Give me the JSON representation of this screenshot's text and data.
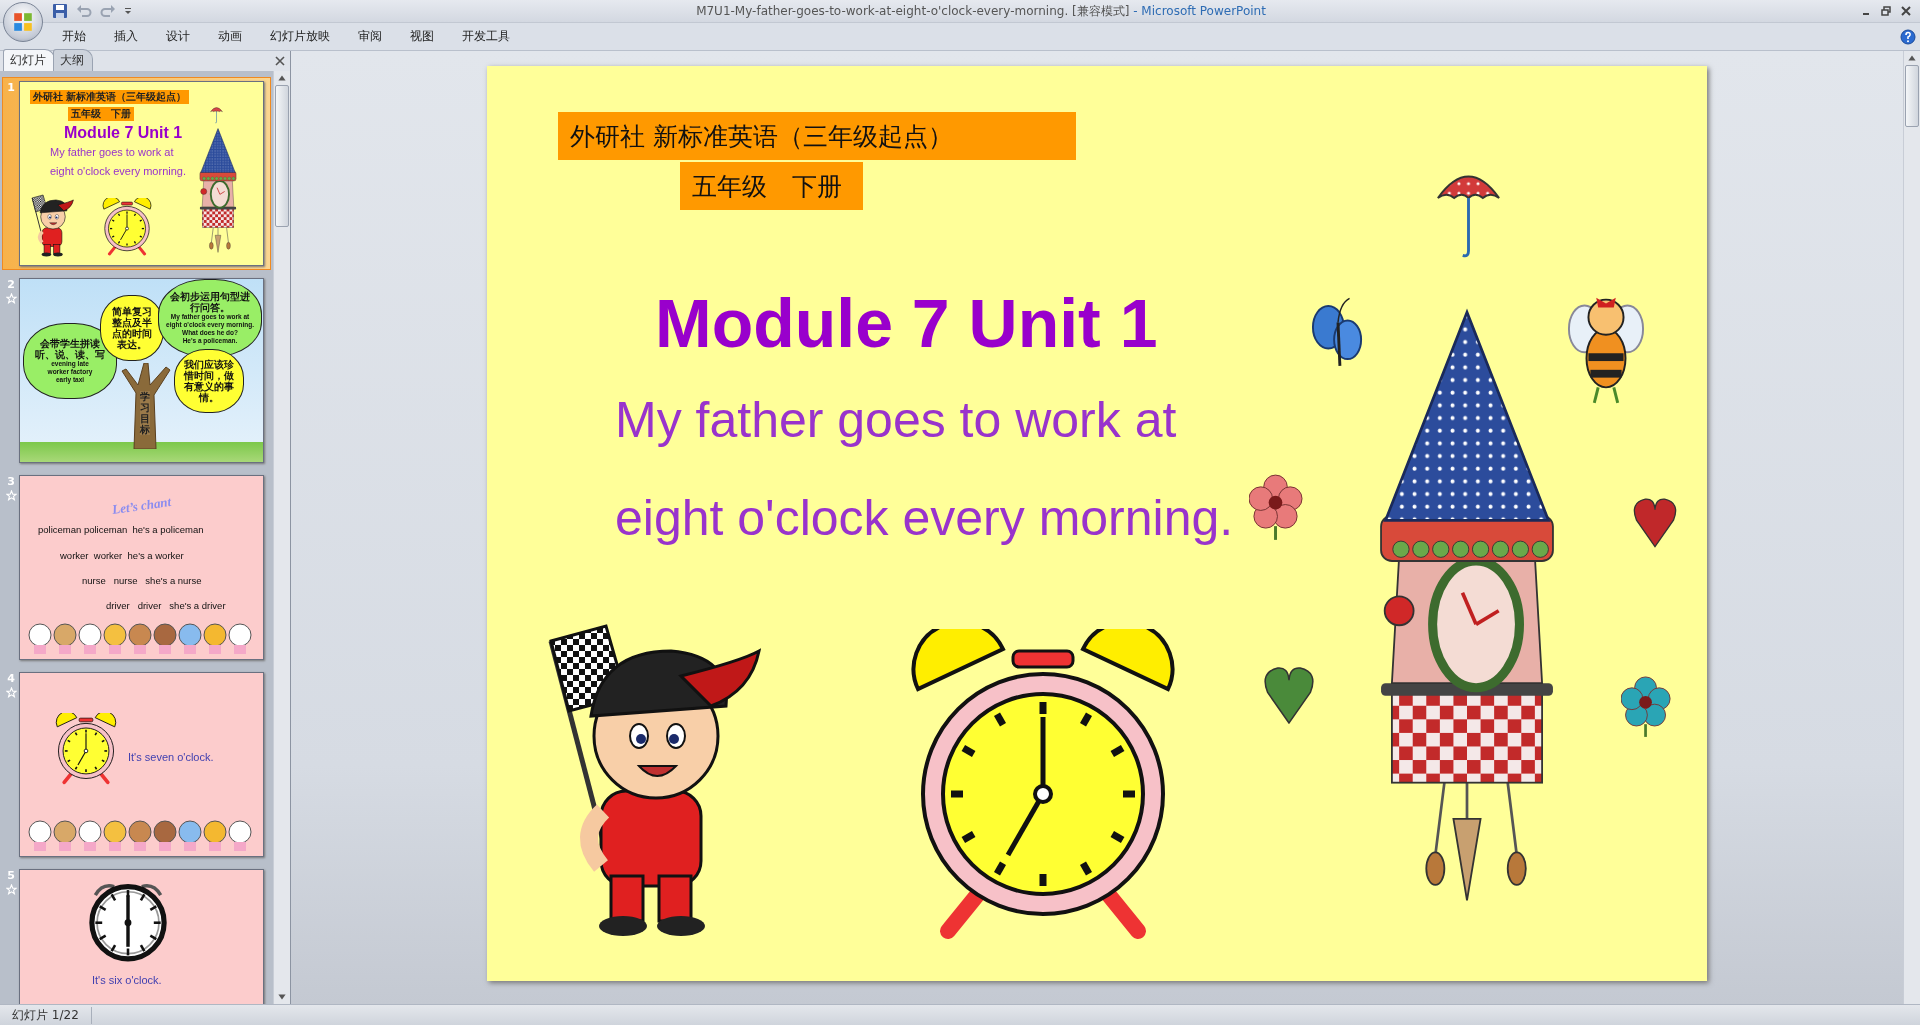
{
  "window": {
    "title": "M7U1-My-father-goes-to-work-at-eight-o'clock-every-morning. [兼容模式]",
    "app_name": "- Microsoft PowerPoint"
  },
  "ribbon_tabs": [
    {
      "label": "开始",
      "selected": false
    },
    {
      "label": "插入",
      "selected": false
    },
    {
      "label": "设计",
      "selected": false
    },
    {
      "label": "动画",
      "selected": false
    },
    {
      "label": "幻灯片放映",
      "selected": false
    },
    {
      "label": "审阅",
      "selected": false
    },
    {
      "label": "视图",
      "selected": false
    },
    {
      "label": "开发工具",
      "selected": false
    }
  ],
  "panel_tabs": [
    {
      "label": "幻灯片",
      "selected": true
    },
    {
      "label": "大纲",
      "selected": false
    }
  ],
  "thumbnails": [
    {
      "number": "1",
      "kind": "title",
      "selected": true,
      "animated": false,
      "header": "外研社 新标准英语（三年级起点）",
      "subheader": "五年级　下册",
      "title": "Module 7 Unit 1",
      "lines": [
        "My father goes to work at",
        "eight o'clock every morning."
      ]
    },
    {
      "number": "2",
      "kind": "goals",
      "selected": false,
      "animated": true,
      "trunk_label": "学习目标",
      "clouds": [
        {
          "color": "#99ee66",
          "text": "会带学生拼读听、说、读、写",
          "english": [
            "evening late",
            "worker factory",
            "early taxi"
          ]
        },
        {
          "color": "#ffff33",
          "text": "简单复习整点及半点的时间表达。"
        },
        {
          "color": "#99ee66",
          "text": "会初步运用句型进行问答。",
          "english": [
            "My father goes to work at",
            "eight o'clock every morning.",
            "What does he do?",
            "He's a policeman."
          ]
        },
        {
          "color": "#ffff33",
          "text": "我们应该珍惜时间，做有意义的事情。"
        }
      ]
    },
    {
      "number": "3",
      "kind": "chant",
      "selected": false,
      "animated": true,
      "heading": "Let’s chant",
      "lines": [
        "policeman policeman  he's a policeman",
        "worker  worker  he's a worker",
        "nurse   nurse   she's a nurse",
        "driver   driver   she's a driver"
      ]
    },
    {
      "number": "4",
      "kind": "alarm",
      "selected": false,
      "animated": true,
      "characters": true,
      "caption": "It's seven o'clock."
    },
    {
      "number": "5",
      "kind": "dial",
      "selected": false,
      "animated": true,
      "characters": false,
      "caption": "It's six o'clock."
    }
  ],
  "slide": {
    "header": "外研社 新标准英语（三年级起点）",
    "subheader": "五年级　下册",
    "title": "Module 7 Unit 1",
    "lines": [
      "My father goes to work at",
      "eight o'clock every morning."
    ]
  },
  "status_bar": {
    "slide_indicator": "幻灯片 1/22"
  }
}
